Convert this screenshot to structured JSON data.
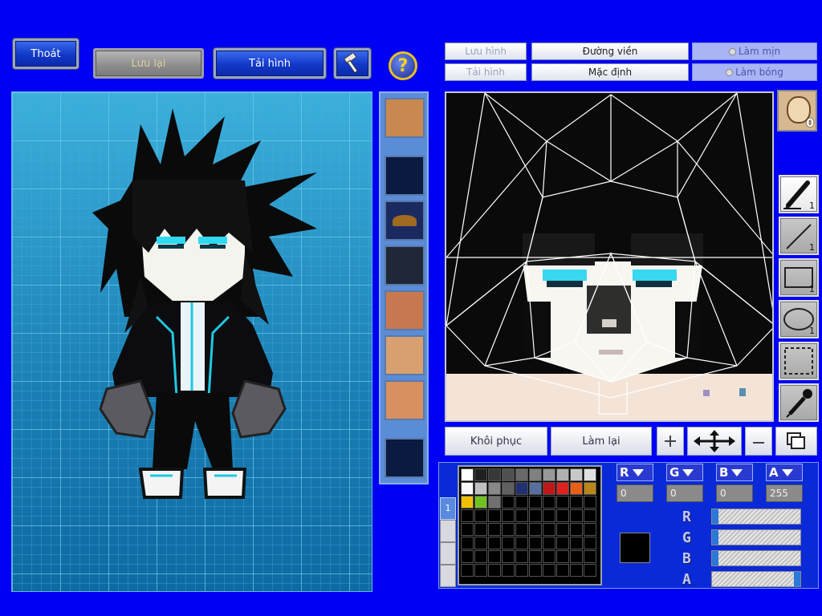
{
  "top_buttons": {
    "exit": "Thoát",
    "save": "Lưu lại",
    "reload": "Tải hình"
  },
  "right_toolbar": {
    "save_image": "Lưu hình",
    "outline": "Đường viền",
    "smooth": "Làm mịn",
    "load_image": "Tải hình",
    "default": "Mặc định",
    "shade": "Làm bóng"
  },
  "face_badge_count": "0",
  "tools": [
    {
      "name": "brush",
      "count": "1"
    },
    {
      "name": "line",
      "count": "1"
    },
    {
      "name": "rectangle",
      "count": "1"
    },
    {
      "name": "ellipse",
      "count": "1"
    },
    {
      "name": "selection",
      "count": ""
    },
    {
      "name": "eyedropper",
      "count": ""
    }
  ],
  "bottom_actions": {
    "restore": "Khôi phục",
    "redo": "Làm lại"
  },
  "color_channels": {
    "labels": [
      "R",
      "G",
      "B",
      "A"
    ],
    "values": [
      "0",
      "0",
      "0",
      "255"
    ]
  },
  "sliders": [
    {
      "label": "R",
      "value": 0
    },
    {
      "label": "G",
      "value": 0
    },
    {
      "label": "B",
      "value": 0
    },
    {
      "label": "A",
      "value": 255
    }
  ],
  "palette_tab": "1",
  "current_color": "#000000",
  "palette_colors": [
    "#ffffff",
    "#202020",
    "#383838",
    "#505050",
    "#686868",
    "#808080",
    "#989898",
    "#b0b0b0",
    "#c8c8c8",
    "#e0e0e0",
    "#f8f8f8",
    "#c0c0c0",
    "#888888",
    "#606060",
    "#203070",
    "#5870a0",
    "#c01818",
    "#e02020",
    "#e86018",
    "#b8861a",
    "#f0c000",
    "#70c020",
    "#707070"
  ]
}
